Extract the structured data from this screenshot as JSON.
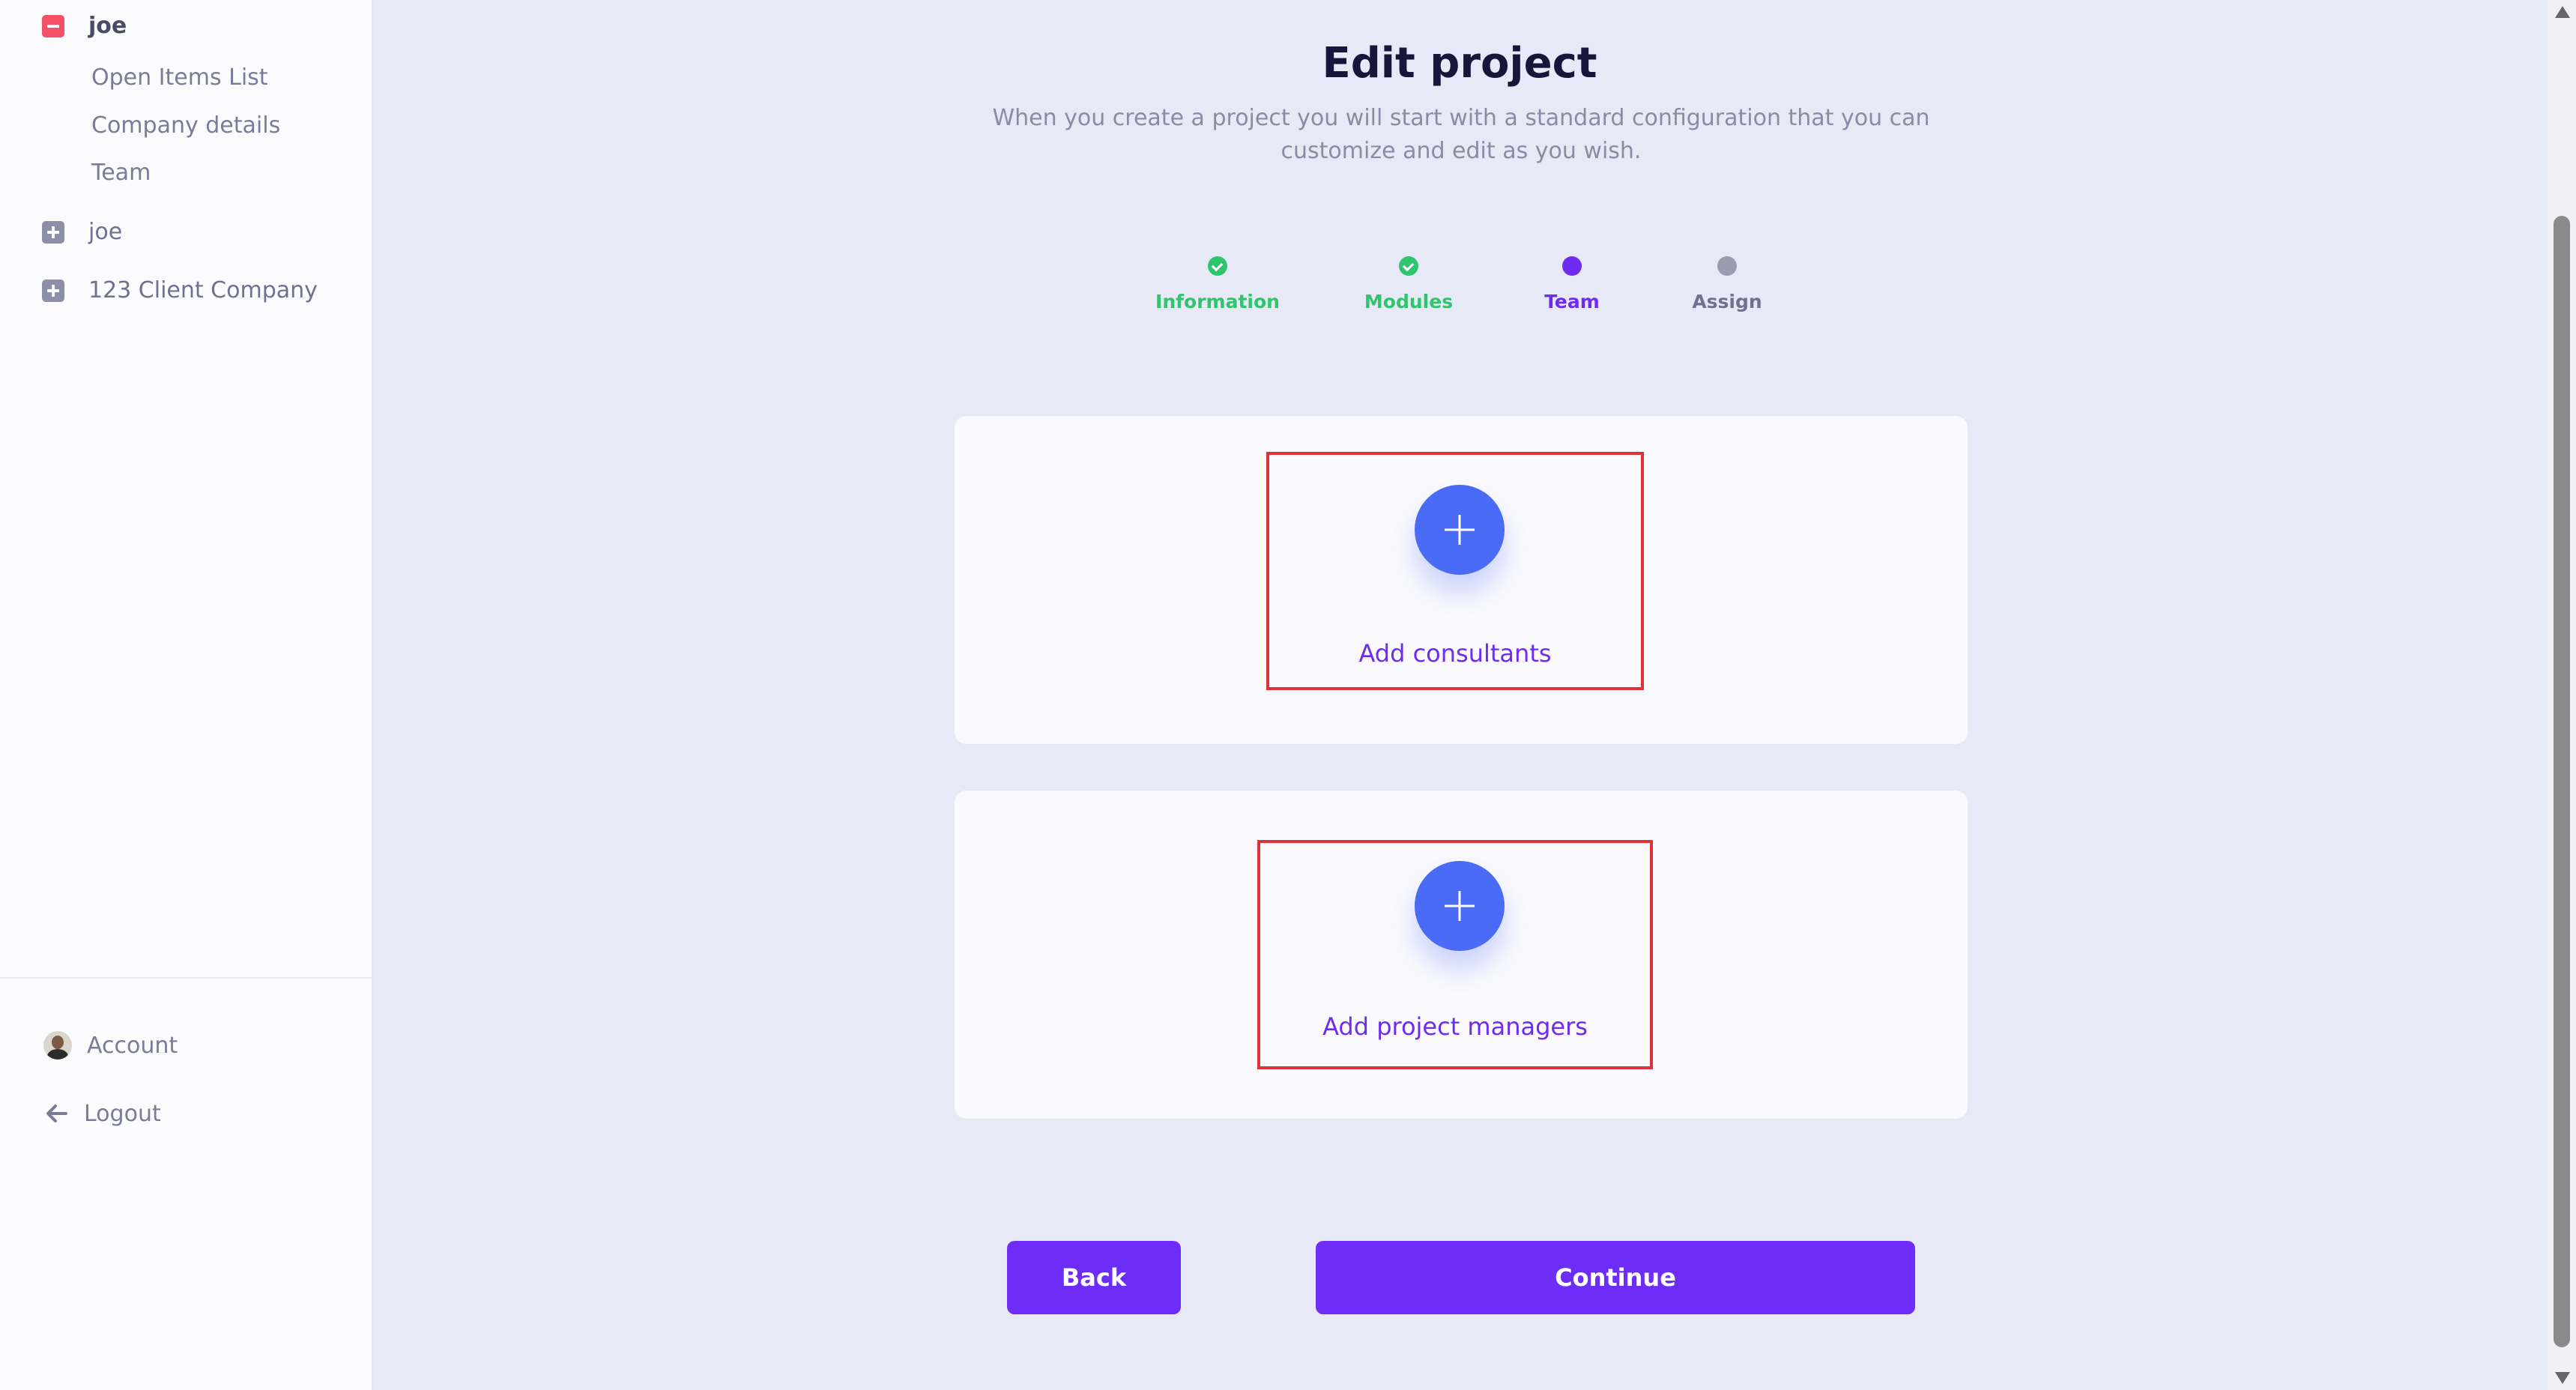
{
  "sidebar": {
    "tree": [
      {
        "label": "joe",
        "expanded": true,
        "icon": "minus-square-icon"
      },
      {
        "label": "joe",
        "expanded": false,
        "icon": "plus-square-icon"
      },
      {
        "label": "123 Client Company",
        "expanded": false,
        "icon": "plus-square-icon"
      }
    ],
    "sub_items": [
      "Open Items List",
      "Company details",
      "Team"
    ],
    "bottom": {
      "account_label": "Account",
      "logout_label": "Logout"
    }
  },
  "main": {
    "title": "Edit project",
    "subtitle": "When you create a project you will start with a standard configuration that you can customize and edit as you wish.",
    "steps": [
      {
        "label": "Information",
        "state": "done"
      },
      {
        "label": "Modules",
        "state": "done"
      },
      {
        "label": "Team",
        "state": "current"
      },
      {
        "label": "Assign",
        "state": "pending"
      }
    ],
    "cards": {
      "consultants_label": "Add consultants",
      "managers_label": "Add project managers"
    },
    "buttons": {
      "back_label": "Back",
      "continue_label": "Continue"
    }
  },
  "colors": {
    "accent": "#6d2cf8",
    "add_circle": "#4a6bf5",
    "step_done": "#2fc46d",
    "highlight_border": "#e0323c"
  }
}
